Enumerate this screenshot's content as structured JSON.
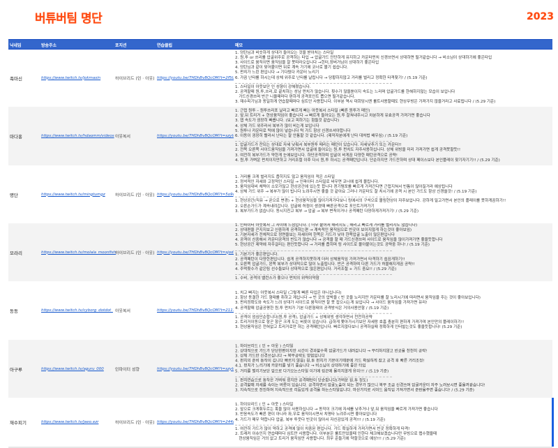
{
  "title": "버튜버팀 명단",
  "year": "2023",
  "columns": {
    "nickname": "닉네임",
    "stream_url": "방송주소",
    "position": "포지션",
    "practice_clip": "연습클립",
    "memo": "메모"
  },
  "rows": [
    {
      "nickname": "족마신",
      "stream_url": "https://www.twitch.tv/jokmasin",
      "position": "하이브리드 (인 · 아웃)",
      "practice_clip": "https://youtu.be/7HDhBvBQcOM?t=2f5tz",
      "memo": [
        [
          "1. 덩탄님과 비슷하게 상대가 들어오는 것을 받아치는 스타일",
          "2. 원,투 or 쓰리를 압굴위주로 공격하는 타입 → 압굴가드 단단하게 유지하고 카운터펀치 신경쓰면서 상대하면 될거같습니다 → 비소님이 상대하기에 좋은타입",
          "3. 사이드로 움직이면 움직임을 잘 못따라오십니다 →힌터,장버거님이 상대하기 좋은타입",
          "4. 덩탄님과 같이 맞어붙이면 뒤로 계속 가기에 코너로 몰기 쉽습니다.",
          "5. 펀치가 느린 편입니다 → 기다렸다 카운터 노리기",
          "6. 가끔 난타를 하시는데 상체 위주로 난타를 날립니다 → 당황하지않고 거리를 벌리고 정확한 타격찾기! / (5.19 기준)"
        ],
        [
          "1. 스타일이 아웃보단 인 성향이 강해졌습니다.",
          "2. 공격할때 원,투,쓰리,로 끝치하는 성남 펀치가 많습니다. 횟수가 많을뿐이지 속도는 느리며 압굴가드를 한해하지않는 모습이 보입니다",
          "   가드신경쓰며 반곤 니올때마다 편하게 공격포인트 뽑으면 될거같습니다.",
          "3. 재수피기님과 동일하게 연습할때마다 심트단 사용합니다. 이부분 역시 대회당시엔 룰트사용할때도 현상무빙은 가져가지 않을거라고 사료됩니다 / (5.29 기준)"
        ]
      ]
    },
    {
      "nickname": "마다홍",
      "stream_url": "https://www.twitch.tv/hdaomm/videos",
      "position": "아웃복서",
      "practice_clip": "https://youtu.be/7HDhBvBQcOM?t=szyt8",
      "memo": [
        [
          "1. 근접 원투 – 원투쓰리포 날리고 빠르게 빠는 아웃복서 스타일 (빠른 원투가 메인)",
          "2. 앞,뒤 트리거 + 현상움직임이 좋습니다 → 빠르게 들어오는 원,투 잘쳐내주시고 차분하게 유효공격 가져가면 좋습니다",
          "3. 잽 속도가 굉장히 빠릅니다. (보고 피하기는 힘들것 같습니다)",
          "4. 상체 가드 위주라서 복부가 많이 비는게 보입니다",
          "5. 원투나 카운터로 턱에 많이 넣습니다 턱 가드 항상 신경쓰셔야합니다",
          "6. 이동이 굉장히 빨라서 난타는 잘 안통할 것 같습니다. (제작자분에게 난타 대처법 배우심) / (5.19 기준)"
        ],
        [
          "1. 압굴가드가 잔되는 상대로 자세 낮춰서 복부원투 때리는 패턴이 있습니다. 자세낮추기 또는 카운터!!",
          "2. 전목 오른쪽 사이드움직임을 가져가면서 압굴에 들어오는 원,투 펀치도 자주사용하십니다. 상체 위빙을 미리 가져가면 쉽게 공격못할듯!!",
          "3. 여전히 복부가드가 약한게 눈에보입니다. 하단공격하며 압굴이 비게끔 다양한 패턴공격으로 공략!",
          "4. 원,투 가벼운 펀치이지만하고 거리조절 이후 다시 원,투 하시는 공격패턴입니다. 단순하지만 가드잔하며 상대 페이스보다 본인플레이 찾기자기기!! / (5.29 기준)"
        ]
      ]
    },
    {
      "nickname": "명단",
      "stream_url": "https://www.twitch.tv/mingtumgz",
      "position": "하이브리드 (인 · 아웃)",
      "practice_clip": "https://youtu.be/7HDhBvBQcOM?t=5o9q",
      "memo": [
        [
          "1. 거리를 크게 벌리지도 좁히지도 않고 움직임이 적은 스타일",
          "2. 정석적인 자세와 고정적인 스타일 → 인파이터 스타일로 싸우면 코너에 쉽게 몰립니다.",
          "3. 움직임대비 체력이 소모가많고 현상공간에 있는듯 합니다 경기템포를 빠르게 가져간다면 근접지쳐서 빈틈이 많아질거라 예상됩니다",
          "4. 상체 가드 위주 → 복부가 많이 빕니다 노려주시면 좋을 것 같아요 그러나 카운터도 잘 치시기에 공격 시 본인 가드도 항상 신경쓸것! / (5.19 기준)"
        ],
        [
          "1. 현상공간(직유 → 곧으로 변경) + 현상움직임을 많이가져가다보니 링에서의 구석으로 몰림현상이 자주보입니다. 강하게 밀고가면서 본인의 플레이를 못하게끔하기!!",
          "2. 오른손가드가 계속내려갑니다. 압굴에 허점이 생겼때 빠른공격으로 포인트가져가기",
          "3. 복부가드가 없습니다. 동시지친고 복부 → 압굴 → 복부 변칙이거나 공격패턴 다양하게가져가기! / (5.29 기준)"
        ]
      ]
    },
    {
      "nickname": "모라리",
      "stream_url": "https://www.twitch.tv/molala_moonfish",
      "position": "하이브리드 (인 · 아웃)",
      "practice_clip": "https://youtu.be/7HDhBvBQcOM?t=sjodl",
      "memo": [
        [
          "1. 인파이터 아웃복서 그 사이에 느낌입니다. ( 너무 붙어서 때리지도 , 때리고 빠르게 거리를 벌리지도 않습니다)",
          "2. 상대편을 끈지지보고 신중하게 공격하는편 → 계속적인 움직임으로 빈곳이 보이지않게 하는것이 좋아보임)",
          "3. 기본자세가 전체적으로 정면을보는 자세이며 한쪽은 가드가 낮아 한쪽압굴 노출이 많은편입니다",
          "4. 공격이 신중해서 카운터공격의 빈도가 많습니다 → 공격을 할 때 가드신경쓰며 사이드로 움직임을 많이가져가면 좋을듯합니다",
          "5. 현상공간 제약에 자주걸리는 편인듯합니다 → 거리를 좁히며 링 사이드로 몰아붙이는것도 공략중 하나! / (5.19 기준)"
        ],
        [
          "1. 기본기가 좋은편입니다.",
          "2. 공격패턴이 다양한편입니다. 쉽게 공격하지못하게 더러 상체움직임 가져가면서 타격하기 쉽끔게하기!!",
          "3. 오른쪽 압굴가드, 왼쪽 복부가 상대적으로 많이 노출됩니다. 반곤 공격하며 다른 가드가 허물해지게끔 공략!!",
          "4. 주먹횟수가 같은팀 선수들보다 상대적으로 많은편입니다. 거리조절 + 가드 중요!! / (5.29 기준)"
        ],
        [
          "1. 수비, 공격의 밸런스가 좋으나 펀치의 위력이약함"
        ]
      ]
    },
    {
      "nickname": "동동",
      "stream_url": "https://www.twitch.tv/cyborg_dotdot_",
      "position": "아웃복서",
      "practice_clip": "https://youtu.be/7HDhBvBQcOM?t=2111",
      "memo": [
        [
          "1. 치고 빠지는 아웃복서 스타일 (그렇게 빠른 타입은 아니십니다)",
          "2. 항상 동결한 가드 형태를 취하고 계십니다 → 빈 곳의 압박을 ( 빈 곳을 노리지만 카운터를 잘 노리시기에 따라면서 움직임을 주는 것이 좋아보입니다)",
          "3. 펀치정확도와 속도가 느려 상대가 사이드로 움직이면 잘 못 잡으시는게 보입니다 → 사이드 움직임을 가져가면 유리!",
          "4. 공격할때 압굴공평한 원,투 펀치가 기본 다른형태의 공격방식은 거의사용안함 / (5.19 기준)"
        ],
        [
          "1. 공격이 엄심단순합니다(원,투 공격), 압굴가드 + 상체위빙 생각하면서 천천히공략",
          "2. 트리거이동으로 항곤 항곤 크게 도는 버릇이 있습니다. 급하게 쫓아가시기보단 자세랑 호흡 충분히 편하게 가져가며 본인만의 플레이하기!!",
          "3. 현상움직임은 전혀없고 트리거로만 하는 공격패턴입니다. 빠르지않다보니 공격하실때 정확하게 인터발는것도 좋을듯합니다! (5.29 기준)"
        ]
      ]
    },
    {
      "nickname": "아구루",
      "stream_url": "https://www.twitch.tv/aguru_000",
      "position": "인파이터 성향",
      "practice_clip": "https://youtu.be/7HDhBvBQcOM?t=szyt8",
      "memo": [
        [
          "1. 하이브리드 ( 인 + 아웃 ) 스타일",
          "2. 상대적으로 가드가 단단한편이지만 시간이 경과할수록 압굴가드가 내려갑니다 → 무리하지않고 빈곳을 천천히 공략!",
          "3. 상체 가드만 신경쓰십니다 → 복부공략도 방법입니다",
          "4. 펀치의 준비 동작이 깁니다 빠르지 않음) 원,투 펀치가 기본이기때문에 가드 확실하게 잡고 공격 후 빠른 거리조정!",
          "4.1. 펀치가 느리기에 카운터를 넣기 좋습니다 → 비소님이 상대하기에 좋은 타입",
          "5. 거리를 벌리기보단 앞으로 다가오는스타일 이기에 링끈에 몰리지않게 유의!!! / (5.19 기준)"
        ],
        [
          "1. 펀치연습으로 동작은 가벼워 졌지만 공격패턴이 단순합니다(가벼운 원,투 정도)",
          "2. 공격할때 자세를 속이는 버릇이 있습니다. 공격하면서 압굴노출이 되는 경우가 많으니 복부 조금 신경쓰며 압굴카운터 자주 노려보시면 좋을꺼같습니다!",
          "3. 지속적으로 전진하며 지속적으로 리듬있게 공격을 하는스타일입니다. 마산가지로 사이드 움직임 가져가면서 준란을주면 좋습니다! / (5.29 기준)"
        ]
      ]
    },
    {
      "nickname": "재수피기",
      "stream_url": "https://www.twitch.tv/jaeo.ezr",
      "position": "하이브리드 (인 · 아웃)",
      "practice_clip": "https://youtu.be/7HDhBvBQcOM?t=244d",
      "memo": [
        [
          "1. 하이브리드 ( 인 + 아웃 ) 스타일",
          "2. 앞으로 크게휘두르는 훅을 많이 사용하십니다 → 동작이 크기에 자세를 낮추거나 앞,뒤 움직임을 빠르게 가져가면 좋습니다",
          "3. 반응속도가 빠른 편이 아니라 좌,우로 움직이시면서 치명타 노려주시면 좋아보입니다",
          "4. 가드가 매우 약합니다 압굴, 복부 투웃다 빈곳이 많아서 자신감있게 공격!!! / (5.19 기준)"
        ],
        [
          "1. 여전히 가드가 많이 약하고 공격에 많이 치중된 편입니다. 가드 확실하게 가져가면서 빈곳 정확하게 타격!",
          "2. 트래커 이슈인지 연습때마다 심트만 사용합니다. 이부분은 룰트만있을때 인한다 체크해보겠습니다만 무빙으로 맵수했을때",
          "   현상움직임은 거의 없고 트리거 움직임만 사용합니다. 최우 준들기에 약할것으로 예상!!! / (5.29 기준)"
        ]
      ]
    }
  ]
}
